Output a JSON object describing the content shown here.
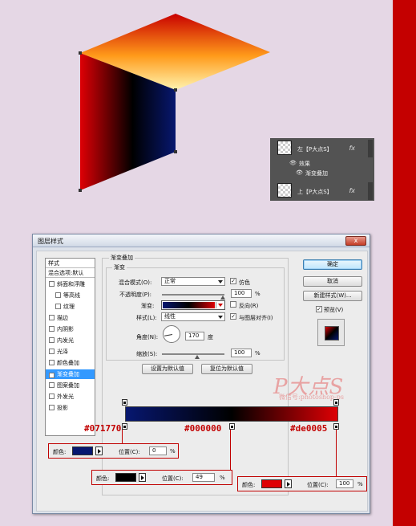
{
  "colors": {
    "start": "#071770",
    "mid": "#000000",
    "end": "#de0005",
    "accent": "#c40000"
  },
  "layers": {
    "layer1": "左【P大点S】",
    "effects": "效果",
    "gradient_overlay": "渐变叠加",
    "layer2": "上【P大点S】",
    "fx": "fx"
  },
  "dialog": {
    "title": "图层样式",
    "close": "x",
    "styles_header": "样式",
    "blend_default": "混合选项:默认",
    "styles": [
      {
        "label": "斜面和浮雕",
        "checked": false
      },
      {
        "label": "等高线",
        "checked": false
      },
      {
        "label": "纹理",
        "checked": false
      },
      {
        "label": "描边",
        "checked": false
      },
      {
        "label": "内阴影",
        "checked": false
      },
      {
        "label": "内发光",
        "checked": false
      },
      {
        "label": "光泽",
        "checked": false
      },
      {
        "label": "颜色叠加",
        "checked": false
      },
      {
        "label": "渐变叠加",
        "checked": true,
        "selected": true
      },
      {
        "label": "图案叠加",
        "checked": false
      },
      {
        "label": "外发光",
        "checked": false
      },
      {
        "label": "投影",
        "checked": false
      }
    ],
    "section_title": "渐变叠加",
    "group_title": "渐变",
    "blend_mode_label": "混合模式(O):",
    "blend_mode_value": "正常",
    "dither_label": "仿色",
    "opacity_label": "不透明度(P):",
    "opacity_value": "100",
    "percent": "%",
    "gradient_label": "渐变:",
    "reverse_label": "反向(R)",
    "style_label": "样式(L):",
    "style_value": "线性",
    "align_label": "与图层对齐(I)",
    "angle_label": "角度(N):",
    "angle_value": "170",
    "degree": "度",
    "scale_label": "缩放(S):",
    "scale_value": "100",
    "set_default": "设置为默认值",
    "reset_default": "复位为默认值",
    "ok": "确定",
    "cancel": "取消",
    "new_style": "新建样式(W)...",
    "preview_label": "预览(V)"
  },
  "watermark": {
    "main": "P大点S",
    "sub": "微信号:photoshop-ps"
  },
  "stops": {
    "hex1": "#071770",
    "hex2": "#000000",
    "hex3": "#de0005",
    "color_label": "颜色:",
    "position_label": "位置(C):",
    "pos1": "0",
    "pos2": "49",
    "pos3": "100",
    "percent": "%"
  }
}
